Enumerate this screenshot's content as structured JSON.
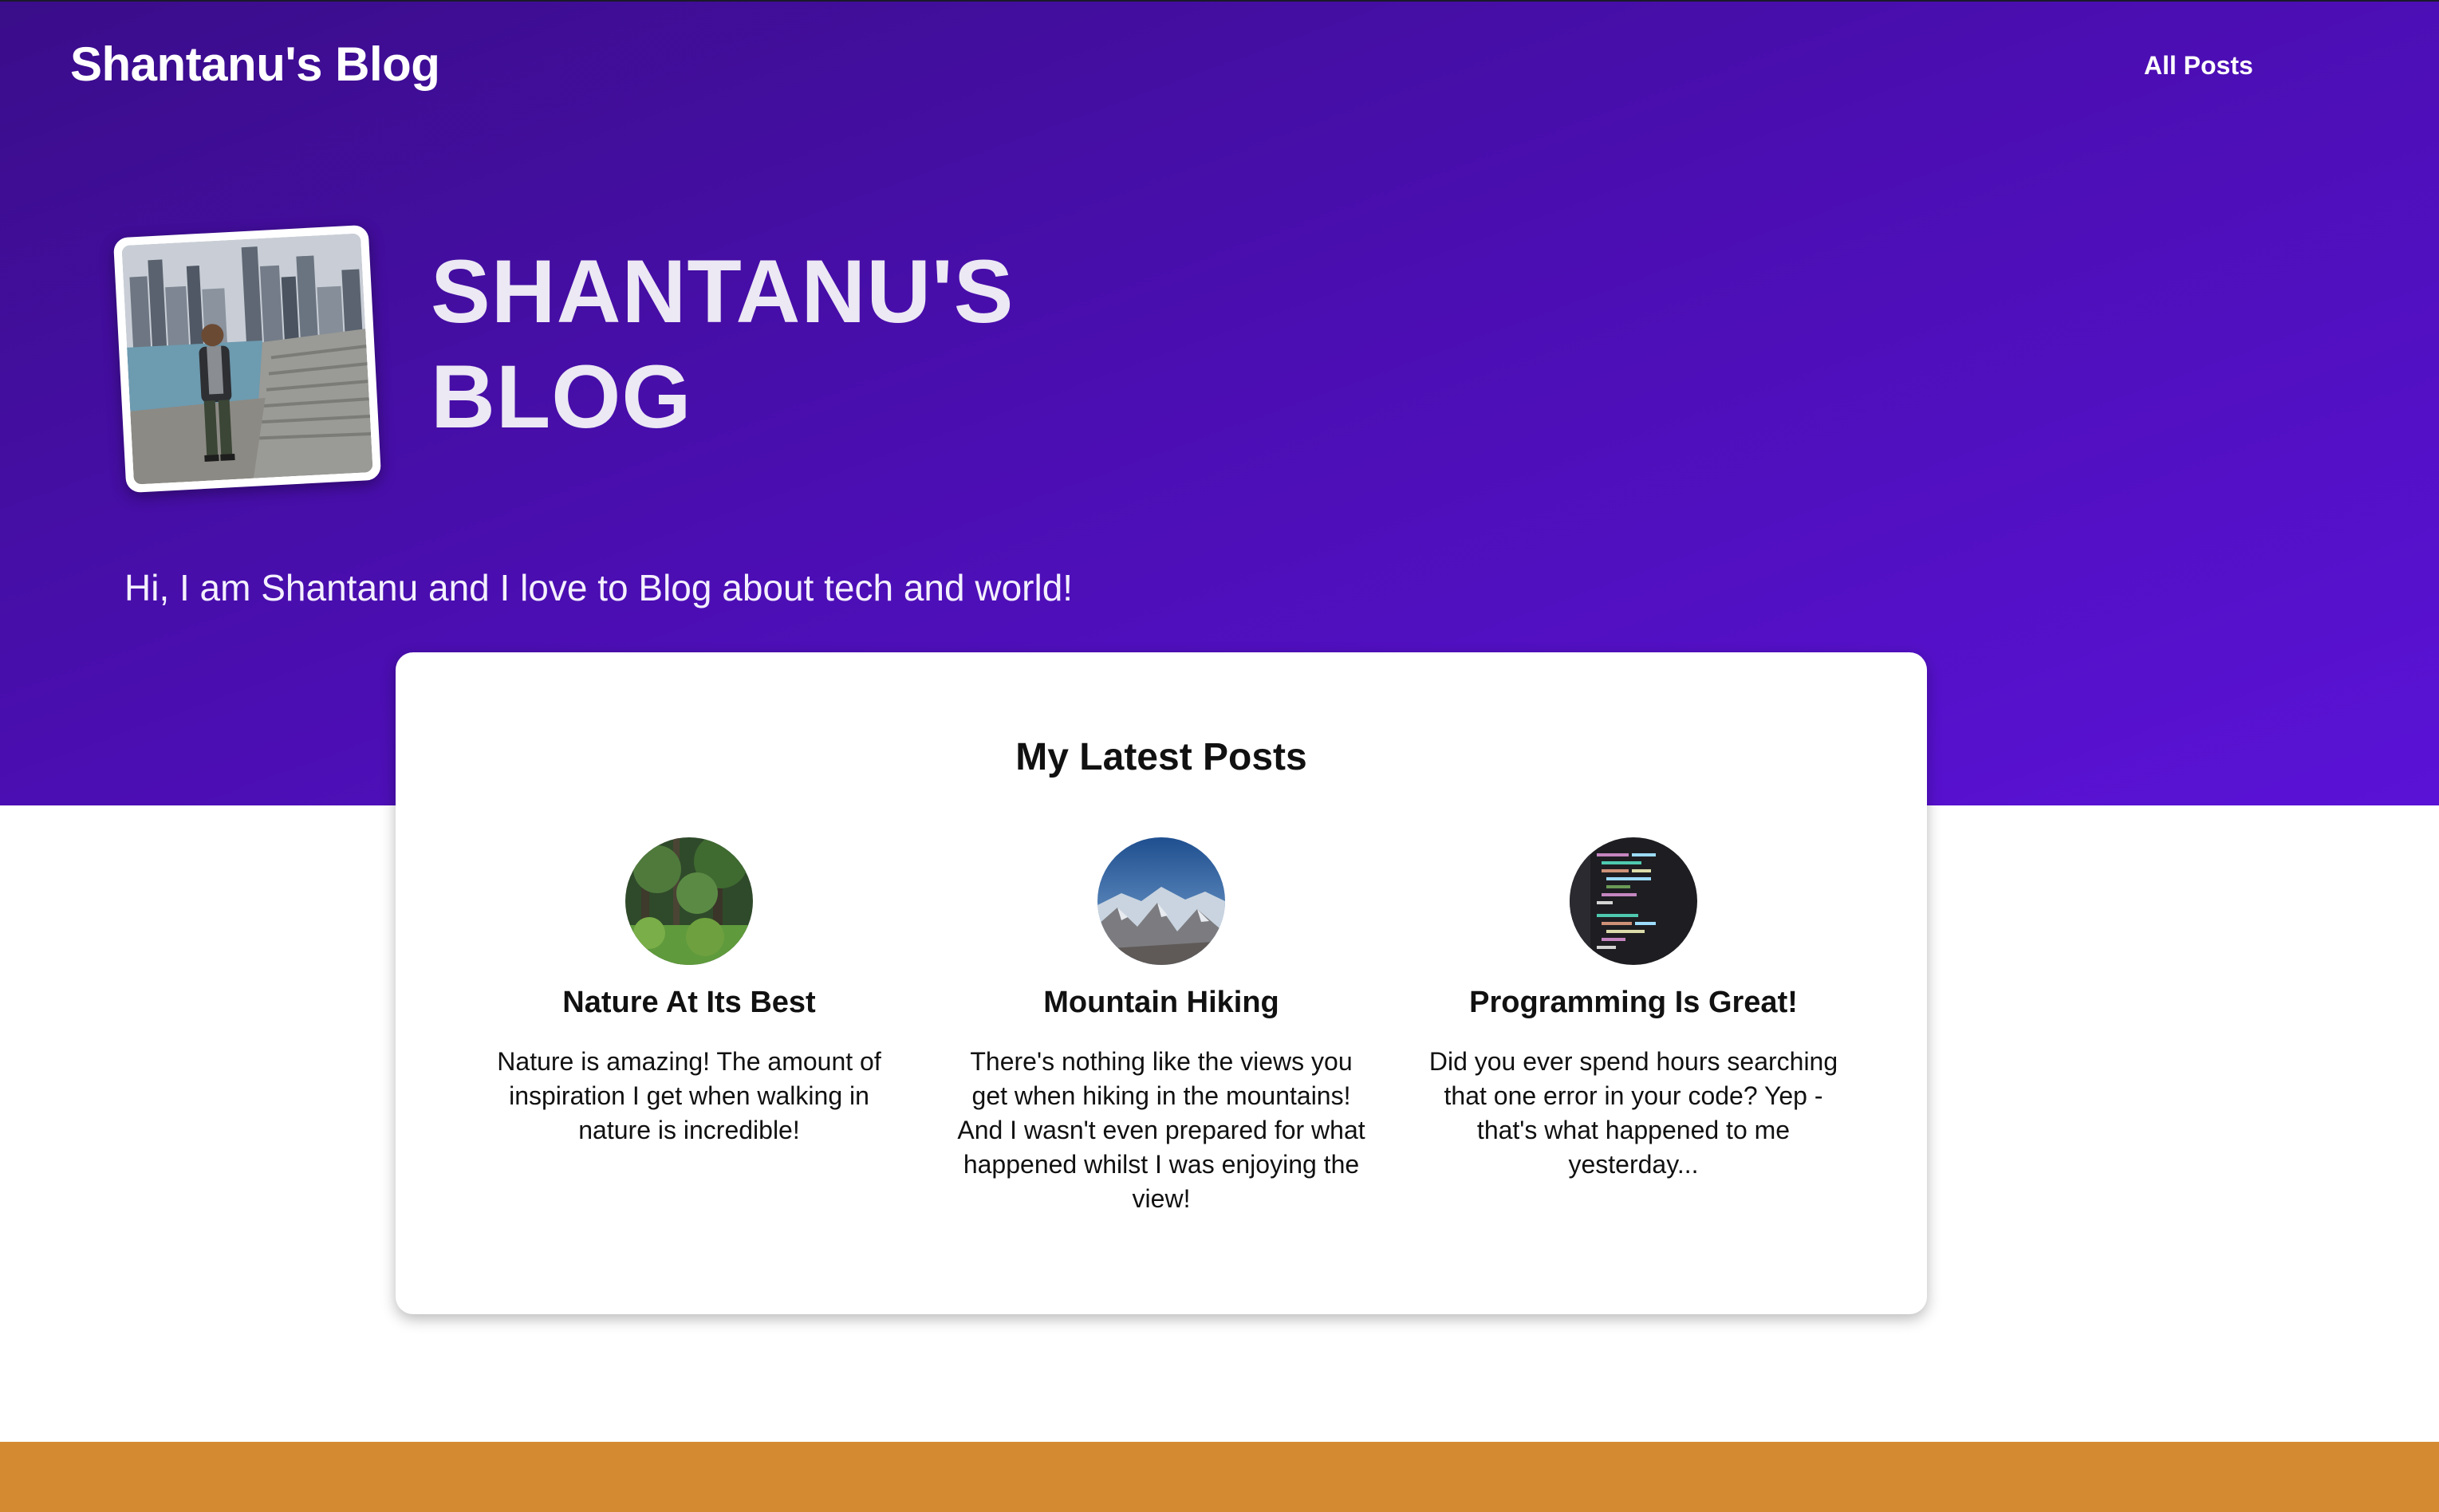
{
  "header": {
    "site_title": "Shantanu's Blog",
    "nav": [
      {
        "label": "All Posts"
      }
    ]
  },
  "hero": {
    "heading_line1": "SHANTANU'S",
    "heading_line2": "BLOG",
    "tagline": "Hi, I am Shantanu and I love to Blog about tech and world!",
    "avatar_icon": "profile-photo"
  },
  "latest_posts": {
    "heading": "My Latest Posts",
    "posts": [
      {
        "title": "Nature At Its Best",
        "excerpt": "Nature is amazing! The amount of inspiration I get when walking in nature is incredible!",
        "thumbnail_icon": "forest-thumbnail"
      },
      {
        "title": "Mountain Hiking",
        "excerpt": "There's nothing like the views you get when hiking in the mountains! And I wasn't even prepared for what happened whilst I was enjoying the view!",
        "thumbnail_icon": "mountain-thumbnail"
      },
      {
        "title": "Programming Is Great!",
        "excerpt": "Did you ever spend hours searching that one error in your code? Yep - that's what happened to me yesterday...",
        "thumbnail_icon": "code-thumbnail"
      }
    ]
  },
  "colors": {
    "hero_gradient_start": "#3a0d8a",
    "hero_gradient_end": "#5a12d6",
    "footer": "#d48a30",
    "card_bg": "#ffffff"
  }
}
